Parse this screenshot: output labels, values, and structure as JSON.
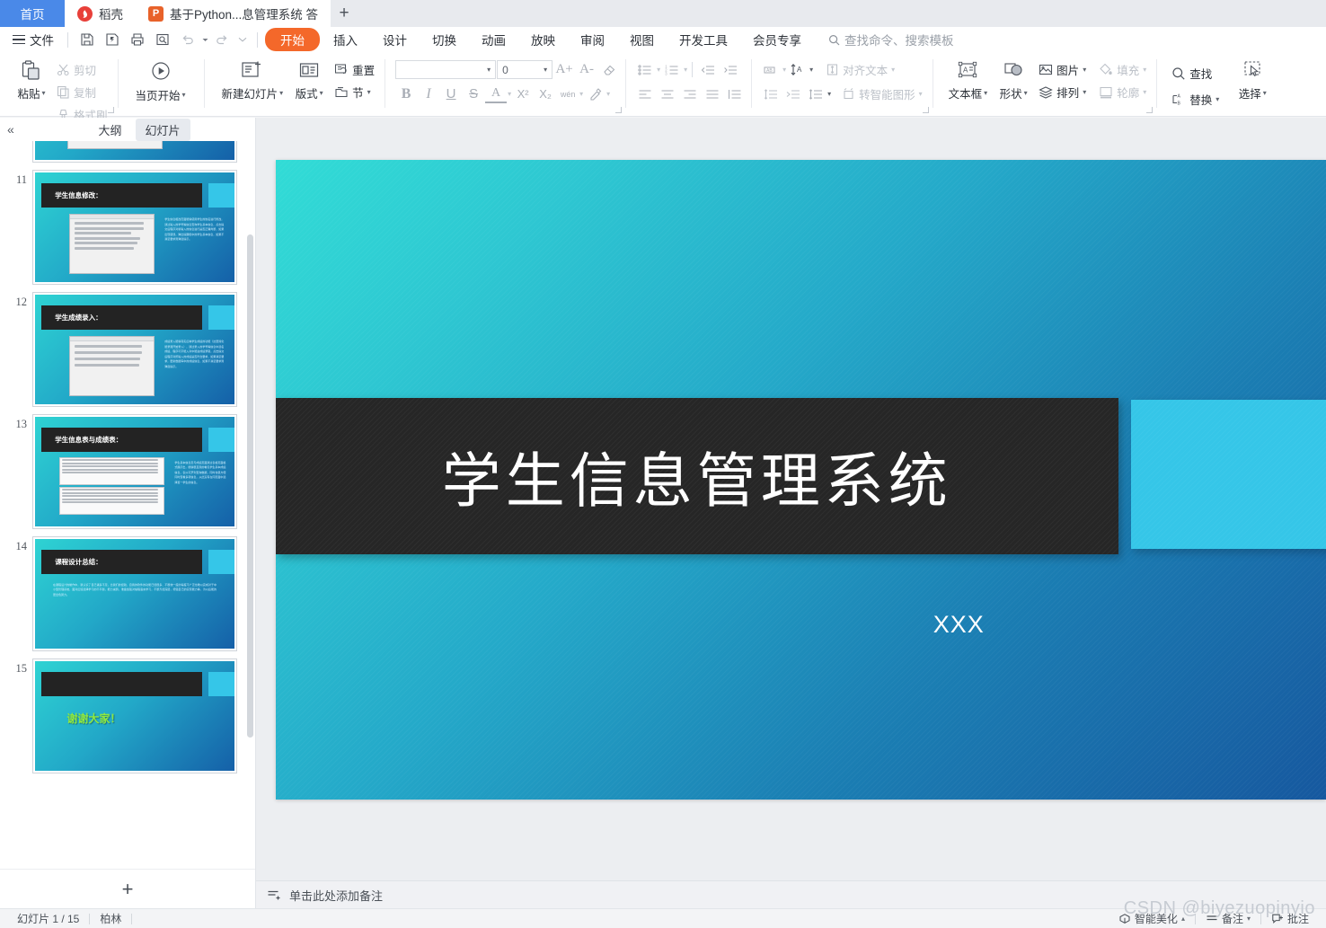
{
  "tabbar": {
    "home_tab": "首页",
    "docer_tab": "稻壳",
    "doc_tab": "基于Python...息管理系统 答",
    "new_tab": "+"
  },
  "menubar": {
    "file": "文件",
    "quick_access": [
      "save-icon",
      "save-as-icon",
      "print-icon",
      "print-preview-icon",
      "undo-icon",
      "redo-icon",
      "customize-icon"
    ],
    "items": [
      "开始",
      "插入",
      "设计",
      "切换",
      "动画",
      "放映",
      "审阅",
      "视图",
      "开发工具",
      "会员专享"
    ],
    "active_item": "开始",
    "search_placeholder": "查找命令、搜索模板"
  },
  "ribbon": {
    "groups": [
      {
        "name": "clipboard",
        "big": {
          "label": "粘贴",
          "icon": "paste-icon",
          "caret": true
        },
        "small": [
          {
            "label": "剪切",
            "icon": "cut-icon",
            "dim": true
          },
          {
            "label": "复制",
            "icon": "copy-icon",
            "dim": true
          },
          {
            "label": "格式刷",
            "icon": "format-painter-icon",
            "dim": true
          }
        ]
      },
      {
        "name": "present",
        "big": {
          "label": "当页开始",
          "icon": "play-icon",
          "caret": true
        }
      },
      {
        "name": "slides",
        "big": {
          "label": "新建幻灯片",
          "icon": "new-slide-icon",
          "caret": true
        },
        "big2": {
          "label": "版式",
          "icon": "layout-icon",
          "caret": true
        },
        "small": [
          {
            "label": "重置",
            "icon": "reset-icon",
            "dim": false
          },
          {
            "label": "节",
            "icon": "section-icon",
            "dim": false
          }
        ]
      },
      {
        "name": "font",
        "font_name": "",
        "font_size": "0",
        "grow": "A+",
        "shrink": "A-",
        "clear_format": "clear-format-icon",
        "bold": "B",
        "italic": "I",
        "underline": "U",
        "strike": "S",
        "text_color": "A",
        "superscript": "X²",
        "subscript": "X₂",
        "phonetic": "wén",
        "highlight": "highlight-icon"
      },
      {
        "name": "paragraph",
        "bullets": "bullet-list-icon",
        "numbers": "numbered-list-icon",
        "outdent": "decrease-indent-icon",
        "indent": "increase-indent-icon",
        "align": [
          "align-left-icon",
          "align-center-icon",
          "align-right-icon",
          "align-justify-icon",
          "align-distribute-icon"
        ],
        "line_spacing": "line-spacing-icon",
        "col_spacing": "column-spacing-icon"
      },
      {
        "name": "textdir",
        "items": [
          {
            "label": "",
            "icon": "text-direction-icon",
            "dim": true
          },
          {
            "label": "",
            "icon": "text-rotate-icon",
            "dim": false
          },
          {
            "label": "对齐文本",
            "icon": "align-text-icon",
            "dim": true
          },
          {
            "label": "转智能图形",
            "icon": "smartart-icon",
            "dim": true
          }
        ]
      },
      {
        "name": "insert",
        "textbox": {
          "label": "文本框",
          "icon": "textbox-icon"
        },
        "shape": {
          "label": "形状",
          "icon": "shape-icon"
        },
        "picture": {
          "label": "图片",
          "icon": "picture-icon"
        },
        "arrange": {
          "label": "排列",
          "icon": "arrange-icon"
        },
        "fill": {
          "label": "填充",
          "icon": "fill-icon",
          "dim": true
        },
        "outline": {
          "label": "轮廓",
          "icon": "outline-icon",
          "dim": true
        }
      },
      {
        "name": "editing",
        "find": {
          "label": "查找",
          "icon": "search-icon"
        },
        "replace": {
          "label": "替换",
          "icon": "replace-icon"
        },
        "select": {
          "label": "选择",
          "icon": "select-icon"
        }
      }
    ]
  },
  "left_panel": {
    "collapse_icon": "collapse-chevrons-icon",
    "tabs": [
      {
        "label": "大纲",
        "active": false
      },
      {
        "label": "幻灯片",
        "active": true
      }
    ],
    "add_slide": "+",
    "slides": [
      {
        "number": "10",
        "type": "partial",
        "title": "",
        "selected": false
      },
      {
        "number": "11",
        "type": "form",
        "title": "学生信息修改：",
        "form_fields": [
          "姓名：小王",
          "性别：男",
          "年龄：22",
          "班级：人数据191",
          "电话：18364646...",
          "学院：电子与信..."
        ],
        "form_right": [
          "学号：007",
          "数据库"
        ],
        "body_text": "学生信息相改页面能够使用学生的姓名进行修改，通过输入的学号等信息查询学生基本信息，点击提交后程序对新输入的信息进行是否正确判断，如果出现错误，弹出提醒框中的学生基本信息，如果不满足要求则弹窗提示。",
        "selected": false
      },
      {
        "number": "12",
        "type": "form",
        "title": "学生成绩录入：",
        "form_fields": [
          "高数：50",
          "物理：100",
          "体育：50",
          "思修：55"
        ],
        "form_right": [
          "学号：007",
          "姓名：小王",
          "班级：大数据班"
        ],
        "body_text": "成绩录入能够真实反映学生成绩的功能（这里简化能录课开始录入），通过录入的学号等信息中选名成绩，程序可字能入对中能进成绩录取，点击提交后程序对所输入的成绩是否符合要求，如果满足要求，更新数据库中的成绩信息，如果不满足要求则弹窗提示。",
        "selected": false
      },
      {
        "number": "13",
        "type": "tables",
        "title": "学生信息表与成绩表：",
        "body_text": "学生基本信息页与成绩页面通过表格页面格式展示出，能够很直观的看见学生基本成绩信息，表以可罗列查询数据，同时也很方便同时查看多项信息，从此没有在同页面中选择置一学生的信息。",
        "selected": false
      },
      {
        "number": "14",
        "type": "text",
        "title": "课程设计总结：",
        "body_text": "在课程设计的制作中，我认识了自己诸多不足，比我们的经验、自我的软件的功能已经很多、不断统一度的得度不广泛也难以完成对于中小型管理系统，面对反馈选择学习的不平衡，能力减弱，准备加强对编程语言学习，不断齐加深层，增强自己的实现能力等，为以后能的更出色努力。",
        "selected": false
      },
      {
        "number": "15",
        "type": "thanks",
        "title": "",
        "thanks_text": "谢谢大家！",
        "selected": false
      }
    ]
  },
  "slide": {
    "title": "学生信息管理系统",
    "subtitle": "XXX",
    "colors": {
      "gradient_start": "#31dcd6",
      "gradient_end": "#16589f",
      "title_band": "#262626",
      "accent": "#35c6e8",
      "title_text": "#ffffff"
    }
  },
  "notes": {
    "icon": "notes-icon",
    "placeholder": "单击此处添加备注"
  },
  "statusbar": {
    "slide_counter": "幻灯片 1 / 15",
    "theme": "柏林",
    "beautify": "智能美化",
    "notes_toggle": "备注",
    "comments_toggle": "批注",
    "beautify_icon": "magic-wand-icon",
    "notes_icon": "notes-panel-icon",
    "comments_icon": "comment-icon"
  },
  "watermark": "CSDN @biyezuopinyio"
}
